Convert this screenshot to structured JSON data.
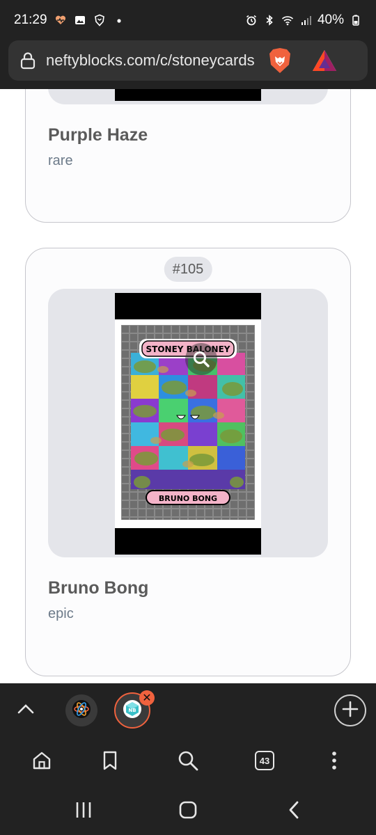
{
  "status_bar": {
    "time": "21:29",
    "battery": "40%",
    "icons_left": [
      "heart-rate-icon",
      "gallery-icon",
      "brave-shield-icon",
      "dot-icon"
    ],
    "icons_right": [
      "alarm-icon",
      "bluetooth-icon",
      "wifi-icon",
      "signal-icon",
      "battery-icon"
    ]
  },
  "address_bar": {
    "url": "neftyblocks.com/c/stoneycards"
  },
  "cards": [
    {
      "title": "Purple Haze",
      "rarity": "rare"
    },
    {
      "mint": "#105",
      "title": "Bruno Bong",
      "rarity": "epic",
      "art": {
        "header_text": "STONEY BALONEY",
        "footer_text": "BRUNO BONG"
      }
    }
  ],
  "tab_strip": {
    "tabs": [
      {
        "icon": "atom-icon",
        "active": false
      },
      {
        "icon": "neftyblocks-icon",
        "active": true
      }
    ]
  },
  "toolbar": {
    "tab_count": "43"
  },
  "colors": {
    "accent": "#f0623e",
    "chrome_bg": "#222222",
    "card_border": "#c6c6cc",
    "image_bg": "#e4e5ea"
  }
}
